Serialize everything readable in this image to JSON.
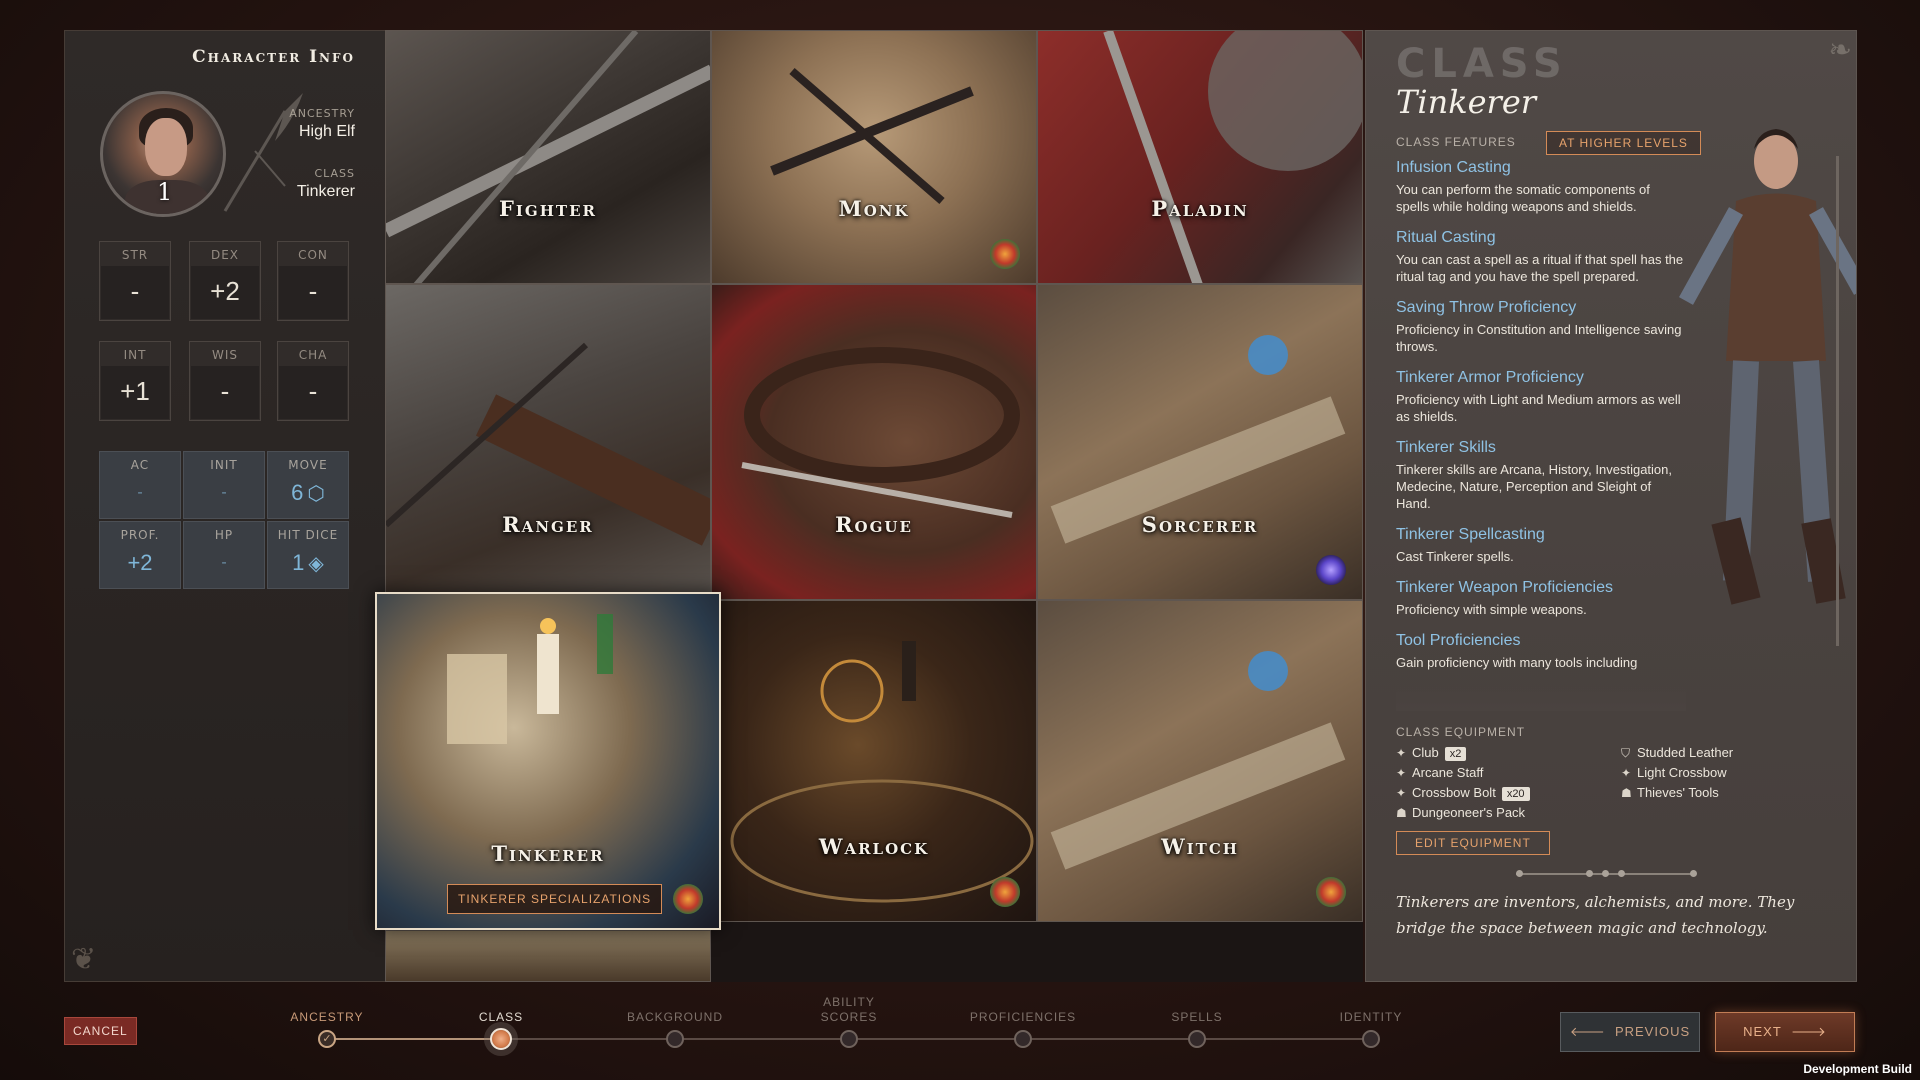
{
  "character_info": {
    "title": "Character Info",
    "ancestry_label": "ANCESTRY",
    "ancestry_value": "High Elf",
    "class_label": "CLASS",
    "class_value": "Tinkerer",
    "level": "1",
    "abilities": [
      {
        "label": "STR",
        "value": "-"
      },
      {
        "label": "DEX",
        "value": "+2"
      },
      {
        "label": "CON",
        "value": "-"
      },
      {
        "label": "INT",
        "value": "+1"
      },
      {
        "label": "WIS",
        "value": "-"
      },
      {
        "label": "CHA",
        "value": "-"
      }
    ],
    "combat": [
      {
        "label": "AC",
        "value": "-"
      },
      {
        "label": "INIT",
        "value": "-"
      },
      {
        "label": "MOVE",
        "value": "6",
        "icon": "cube-icon"
      },
      {
        "label": "PROF.",
        "value": "+2"
      },
      {
        "label": "HP",
        "value": "-"
      },
      {
        "label": "HIT DICE",
        "value": "1",
        "icon": "d8-icon"
      }
    ]
  },
  "classes": [
    {
      "name": "Fighter"
    },
    {
      "name": "Monk",
      "badge": "expansion-badge-icon"
    },
    {
      "name": "Paladin"
    },
    {
      "name": "Ranger"
    },
    {
      "name": "Rogue"
    },
    {
      "name": "Sorcerer",
      "badge": "arcane-badge-icon"
    },
    {
      "name": "Tinkerer",
      "badge": "expansion-badge-icon",
      "selected": true,
      "button": "TINKERER SPECIALIZATIONS"
    },
    {
      "name": "Warlock",
      "badge": "expansion-badge-icon"
    },
    {
      "name": "Witch",
      "badge": "expansion-badge-icon"
    }
  ],
  "detail": {
    "header": "CLASS",
    "name": "Tinkerer",
    "features_label": "CLASS FEATURES",
    "higher_levels_button": "AT HIGHER LEVELS",
    "features": [
      {
        "title": "Infusion Casting",
        "desc": "You can perform the somatic components of spells while holding weapons and shields."
      },
      {
        "title": "Ritual Casting",
        "desc": "You can cast a spell as a ritual if that spell has the ritual tag and you have the spell prepared."
      },
      {
        "title": "Saving Throw Proficiency",
        "desc": "Proficiency in Constitution and Intelligence saving throws."
      },
      {
        "title": "Tinkerer Armor Proficiency",
        "desc": "Proficiency with Light and Medium armors as well as shields."
      },
      {
        "title": "Tinkerer Skills",
        "desc": "Tinkerer skills are Arcana, History, Investigation, Medecine, Nature, Perception and Sleight of Hand."
      },
      {
        "title": "Tinkerer Spellcasting",
        "desc": "Cast Tinkerer spells."
      },
      {
        "title": "Tinkerer Weapon Proficiencies",
        "desc": "Proficiency with simple weapons."
      },
      {
        "title": "Tool Proficiencies",
        "desc": "Gain proficiency with many tools including"
      }
    ],
    "equipment_label": "CLASS EQUIPMENT",
    "equipment_left": [
      {
        "name": "Club",
        "qty": "x2",
        "icon": "weapon-icon"
      },
      {
        "name": "Arcane Staff",
        "qty": "",
        "icon": "weapon-icon"
      },
      {
        "name": "Crossbow Bolt",
        "qty": "x20",
        "icon": "weapon-icon"
      },
      {
        "name": "Dungeoneer's Pack",
        "qty": "",
        "icon": "pack-icon"
      }
    ],
    "equipment_right": [
      {
        "name": "Studded Leather",
        "qty": "",
        "icon": "armor-icon"
      },
      {
        "name": "Light Crossbow",
        "qty": "",
        "icon": "weapon-icon"
      },
      {
        "name": "Thieves' Tools",
        "qty": "",
        "icon": "pack-icon"
      }
    ],
    "edit_equipment_button": "EDIT EQUIPMENT",
    "description": "Tinkerers are inventors, alchemists, and more. They bridge the space between magic and technology."
  },
  "footer": {
    "cancel": "CANCEL",
    "steps": [
      {
        "label": "ANCESTRY",
        "state": "done"
      },
      {
        "label": "CLASS",
        "state": "active"
      },
      {
        "label": "BACKGROUND",
        "state": "pending"
      },
      {
        "label": "ABILITY SCORES",
        "state": "pending"
      },
      {
        "label": "PROFICIENCIES",
        "state": "pending"
      },
      {
        "label": "SPELLS",
        "state": "pending"
      },
      {
        "label": "IDENTITY",
        "state": "pending"
      }
    ],
    "previous": "PREVIOUS",
    "next": "NEXT",
    "dev_build": "Development Build"
  }
}
